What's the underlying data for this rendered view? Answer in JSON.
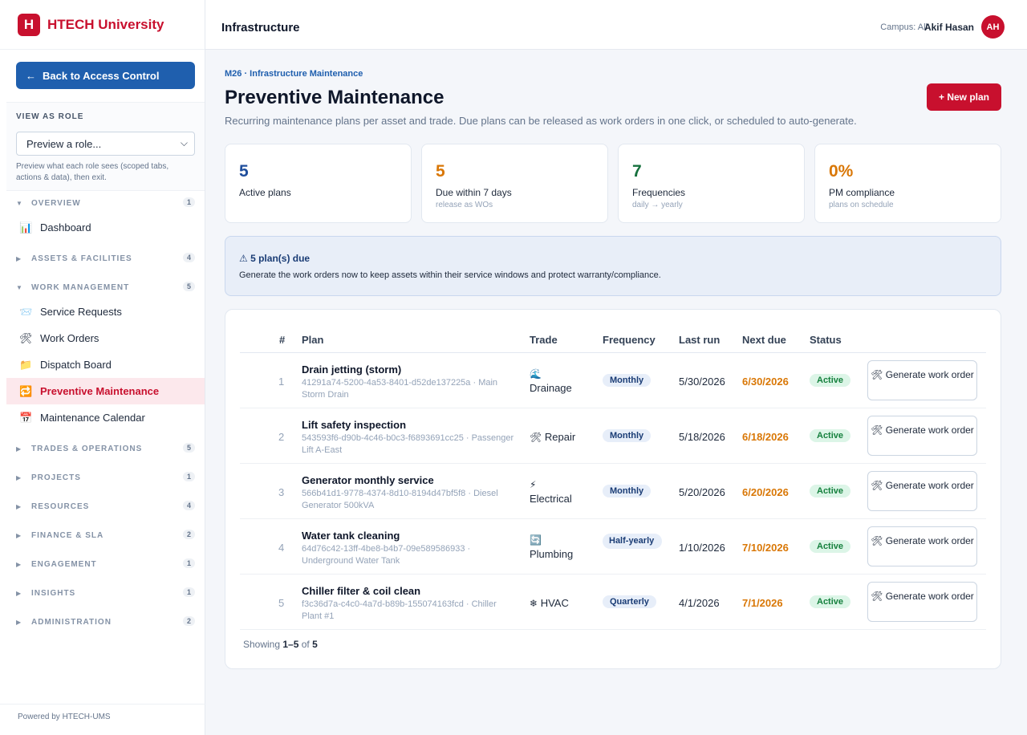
{
  "brand": {
    "logo_letter": "H",
    "name": "HTECH University",
    "color": "#c8102e"
  },
  "sidebar": {
    "back_label": "Back to Access Control",
    "back_arrow": "←",
    "role": {
      "heading": "VIEW AS ROLE",
      "select_value": "Preview a role...",
      "help": "Preview what each role sees (scoped tabs, actions & data), then exit."
    },
    "sections": [
      {
        "label": "OVERVIEW",
        "count": "1",
        "expanded": true
      },
      {
        "label": "ASSETS & FACILITIES",
        "count": "4",
        "expanded": false
      },
      {
        "label": "WORK MANAGEMENT",
        "count": "5",
        "expanded": true
      },
      {
        "label": "TRADES & OPERATIONS",
        "count": "5",
        "expanded": false
      },
      {
        "label": "PROJECTS",
        "count": "1",
        "expanded": false
      },
      {
        "label": "RESOURCES",
        "count": "4",
        "expanded": false
      },
      {
        "label": "FINANCE & SLA",
        "count": "2",
        "expanded": false
      },
      {
        "label": "ENGAGEMENT",
        "count": "1",
        "expanded": false
      },
      {
        "label": "INSIGHTS",
        "count": "1",
        "expanded": false
      },
      {
        "label": "ADMINISTRATION",
        "count": "2",
        "expanded": false
      }
    ],
    "items": [
      {
        "label": "Dashboard",
        "icon": "📊"
      },
      {
        "label": "Service Requests",
        "icon": "📨"
      },
      {
        "label": "Work Orders",
        "icon": "🛠"
      },
      {
        "label": "Dispatch Board",
        "icon": "📁"
      },
      {
        "label": "Preventive Maintenance",
        "icon": "🔁",
        "active": true
      },
      {
        "label": "Maintenance Calendar",
        "icon": "📅"
      }
    ],
    "caret_open": "▼",
    "caret_closed": "▶",
    "powered_by": "Powered by HTECH-UMS"
  },
  "topbar": {
    "title": "Infrastructure",
    "campus": "Campus: All",
    "user": "Akif Hasan",
    "avatar_initials": "AH"
  },
  "page": {
    "eyebrow": "M26 · Infrastructure Maintenance",
    "title": "Preventive Maintenance",
    "subtitle": "Recurring maintenance plans per asset and trade. Due plans can be released as work orders in one click, or scheduled to auto-generate.",
    "new_plan_label": "+ New plan"
  },
  "stats": [
    {
      "value": "5",
      "label": "Active plans",
      "sub": "",
      "color": "#1f4e9c"
    },
    {
      "value": "5",
      "label": "Due within 7 days",
      "sub": "release as WOs",
      "color": "#d97706"
    },
    {
      "value": "7",
      "label": "Frequencies",
      "sub": "daily → yearly",
      "color": "#15703d"
    },
    {
      "value": "0%",
      "label": "PM compliance",
      "sub": "plans on schedule",
      "color": "#d97706"
    }
  ],
  "alert": {
    "title": "⚠ 5 plan(s) due",
    "text": "Generate the work orders now to keep assets within their service windows and protect warranty/compliance."
  },
  "table": {
    "headers": {
      "num": "#",
      "plan": "Plan",
      "trade": "Trade",
      "frequency": "Frequency",
      "last_run": "Last run",
      "next_due": "Next due",
      "status": "Status"
    },
    "action_label": "🛠 Generate work order",
    "rows": [
      {
        "num": "1",
        "name": "Drain jetting (storm)",
        "meta": "41291a74-5200-4a53-8401-d52de137225a · Main Storm Drain",
        "trade_icon": "🌊",
        "trade": "Drainage",
        "frequency": "Monthly",
        "last_run": "5/30/2026",
        "next_due": "6/30/2026",
        "status": "Active"
      },
      {
        "num": "2",
        "name": "Lift safety inspection",
        "meta": "543593f6-d90b-4c46-b0c3-f6893691cc25 · Passenger Lift A-East",
        "trade_icon": "🛠",
        "trade": "Repair",
        "frequency": "Monthly",
        "last_run": "5/18/2026",
        "next_due": "6/18/2026",
        "status": "Active"
      },
      {
        "num": "3",
        "name": "Generator monthly service",
        "meta": "566b41d1-9778-4374-8d10-8194d47bf5f8 · Diesel Generator 500kVA",
        "trade_icon": "⚡",
        "trade": "Electrical",
        "frequency": "Monthly",
        "last_run": "5/20/2026",
        "next_due": "6/20/2026",
        "status": "Active"
      },
      {
        "num": "4",
        "name": "Water tank cleaning",
        "meta": "64d76c42-13ff-4be8-b4b7-09e589586933 · Underground Water Tank",
        "trade_icon": "🔄",
        "trade": "Plumbing",
        "frequency": "Half-yearly",
        "last_run": "1/10/2026",
        "next_due": "7/10/2026",
        "status": "Active"
      },
      {
        "num": "5",
        "name": "Chiller filter & coil clean",
        "meta": "f3c36d7a-c4c0-4a7d-b89b-155074163fcd · Chiller Plant #1",
        "trade_icon": "❄",
        "trade": "HVAC",
        "frequency": "Quarterly",
        "last_run": "4/1/2026",
        "next_due": "7/1/2026",
        "status": "Active"
      }
    ],
    "showing": {
      "prefix": "Showing",
      "range": "1–5",
      "of": "of",
      "total": "5"
    }
  }
}
